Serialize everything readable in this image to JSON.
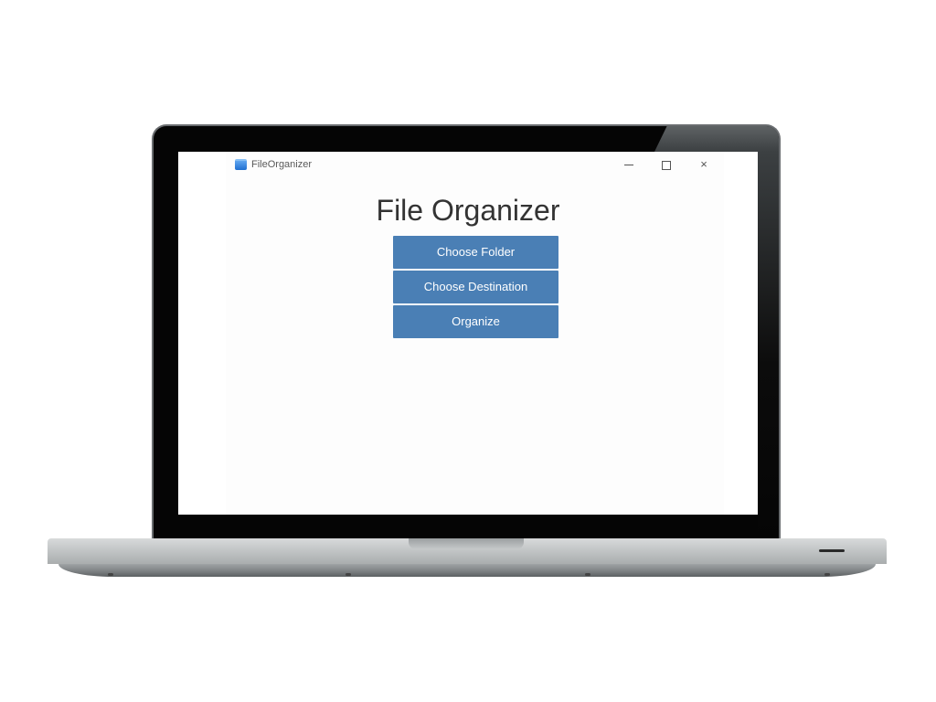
{
  "window": {
    "title": "FileOrganizer",
    "icon": "folder-icon",
    "controls": {
      "minimize": "minimize-icon",
      "maximize": "maximize-icon",
      "close": "×"
    }
  },
  "main": {
    "heading": "File Organizer",
    "buttons": {
      "choose_folder": "Choose Folder",
      "choose_destination": "Choose Destination",
      "organize": "Organize"
    }
  },
  "colors": {
    "button_bg": "#4a7fb5",
    "button_text": "#ffffff",
    "heading_text": "#333333"
  }
}
